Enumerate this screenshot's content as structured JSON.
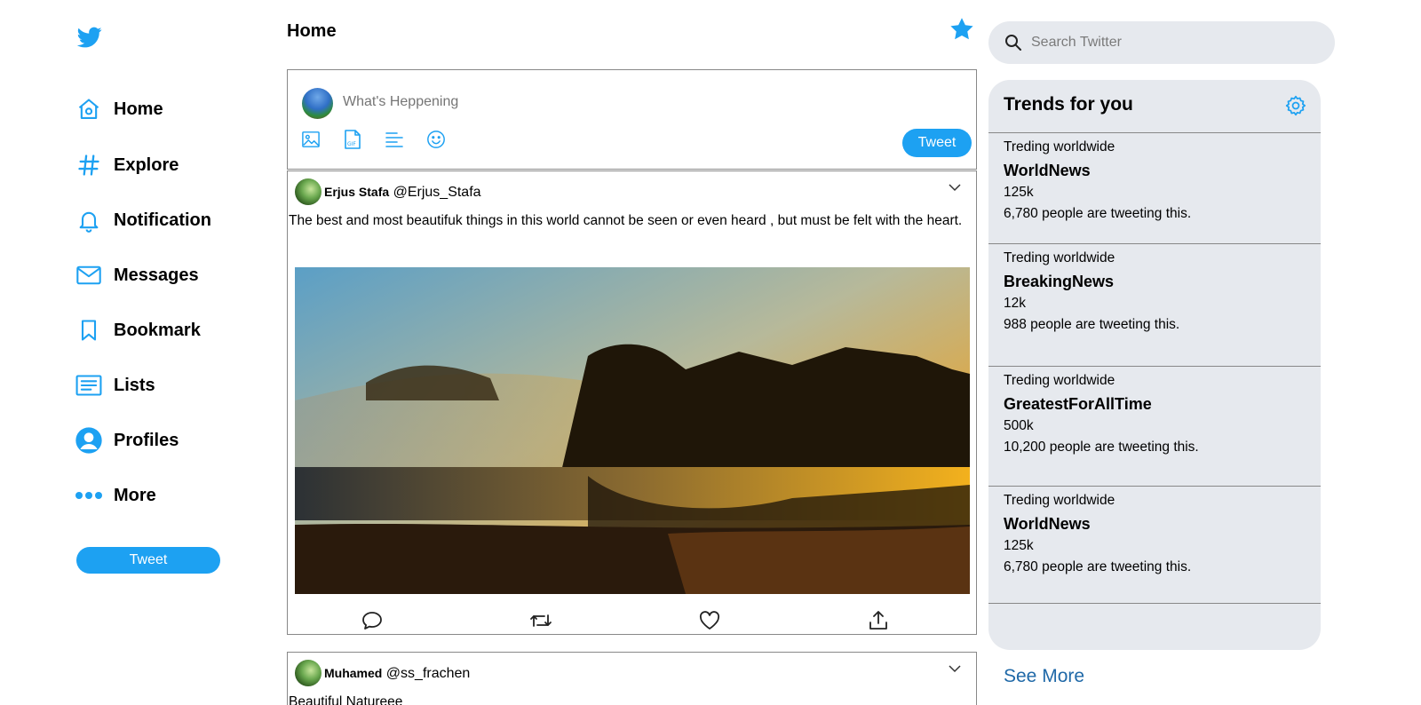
{
  "sidebar": {
    "logo_icon": "twitter-bird-icon",
    "items": [
      {
        "label": "Home",
        "icon": "home-icon"
      },
      {
        "label": "Explore",
        "icon": "hashtag-icon"
      },
      {
        "label": "Notification",
        "icon": "bell-icon"
      },
      {
        "label": "Messages",
        "icon": "envelope-icon"
      },
      {
        "label": "Bookmark",
        "icon": "bookmark-icon"
      },
      {
        "label": "Lists",
        "icon": "list-icon"
      },
      {
        "label": "Profiles",
        "icon": "user-icon"
      },
      {
        "label": "More",
        "icon": "more-dots-icon"
      }
    ],
    "tweet_button": "Tweet"
  },
  "main": {
    "title": "Home",
    "composer": {
      "placeholder": "What's Heppening",
      "tools": [
        "image-icon",
        "gif-icon",
        "poll-icon",
        "emoji-icon"
      ],
      "tweet_button": "Tweet"
    },
    "tweets": [
      {
        "name": "Erjus Stafa",
        "handle": "@Erjus_Stafa",
        "text": "The best and most beautifuk things in this world cannot be seen or even heard , but must be felt with the heart."
      },
      {
        "name": "Muhamed",
        "handle": "@ss_frachen",
        "text": "Beautiful Natureee"
      }
    ],
    "tweet_actions": [
      "reply-icon",
      "retweet-icon",
      "like-icon",
      "share-icon"
    ]
  },
  "search": {
    "placeholder": "Search Twitter"
  },
  "trends": {
    "title": "Trends for you",
    "items": [
      {
        "label": "Treding worldwide",
        "tag": "WorldNews",
        "count": "125k",
        "people": "6,780 people are tweeting this."
      },
      {
        "label": "Treding worldwide",
        "tag": "BreakingNews",
        "count": "12k",
        "people": "988 people are tweeting this."
      },
      {
        "label": "Treding worldwide",
        "tag": "GreatestForAllTime",
        "count": "500k",
        "people": "10,200 people are tweeting this."
      },
      {
        "label": "Treding worldwide",
        "tag": "WorldNews",
        "count": "125k",
        "people": "6,780 people are tweeting this."
      }
    ],
    "see_more": "See More"
  },
  "colors": {
    "accent": "#1da1f2",
    "panel": "#e6e9ee",
    "link": "#2069a8"
  }
}
